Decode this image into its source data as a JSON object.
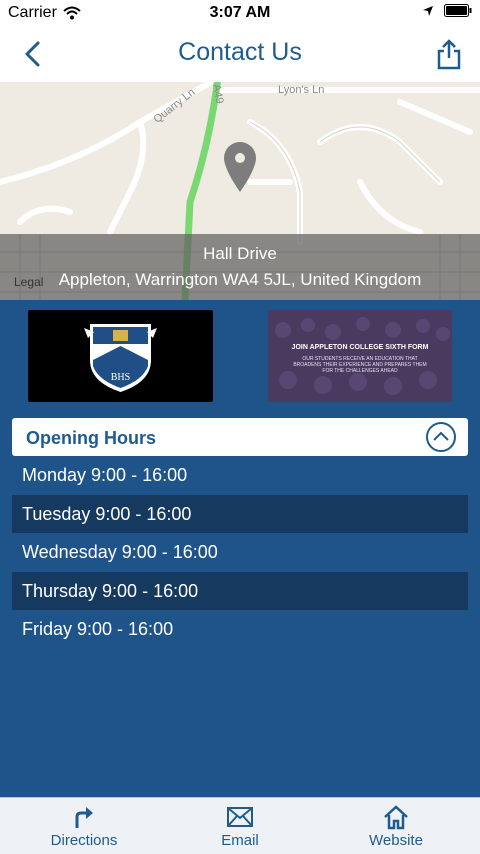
{
  "status_bar": {
    "carrier": "Carrier",
    "time": "3:07 AM"
  },
  "nav": {
    "title": "Contact Us"
  },
  "map": {
    "address_line1": "Hall Drive",
    "address_line2": "Appleton, Warrington WA4 5JL, United Kingdom",
    "legal": "Legal",
    "road_labels": [
      "Quarry Ln",
      "A49",
      "Lyon's Ln"
    ]
  },
  "images": {
    "logo_alt": "School crest logo",
    "promo_title": "JOIN APPLETON COLLEGE SIXTH FORM",
    "promo_sub": "OUR STUDENTS RECEIVE AN EDUCATION THAT BROADENS THEIR EXPERIENCE AND PREPARES THEM FOR THE CHALLENGES AHEAD"
  },
  "hours": {
    "header": "Opening Hours",
    "rows": [
      "Monday 9:00 - 16:00",
      "Tuesday 9:00 - 16:00",
      "Wednesday 9:00 - 16:00",
      "Thursday 9:00 - 16:00",
      "Friday 9:00 - 16:00"
    ]
  },
  "tabs": [
    {
      "label": "Directions",
      "icon": "directions-icon"
    },
    {
      "label": "Email",
      "icon": "email-icon"
    },
    {
      "label": "Website",
      "icon": "home-icon"
    }
  ],
  "colors": {
    "brand": "#1f5c8d",
    "background": "#1f548b",
    "row_alt": "#15395f"
  }
}
